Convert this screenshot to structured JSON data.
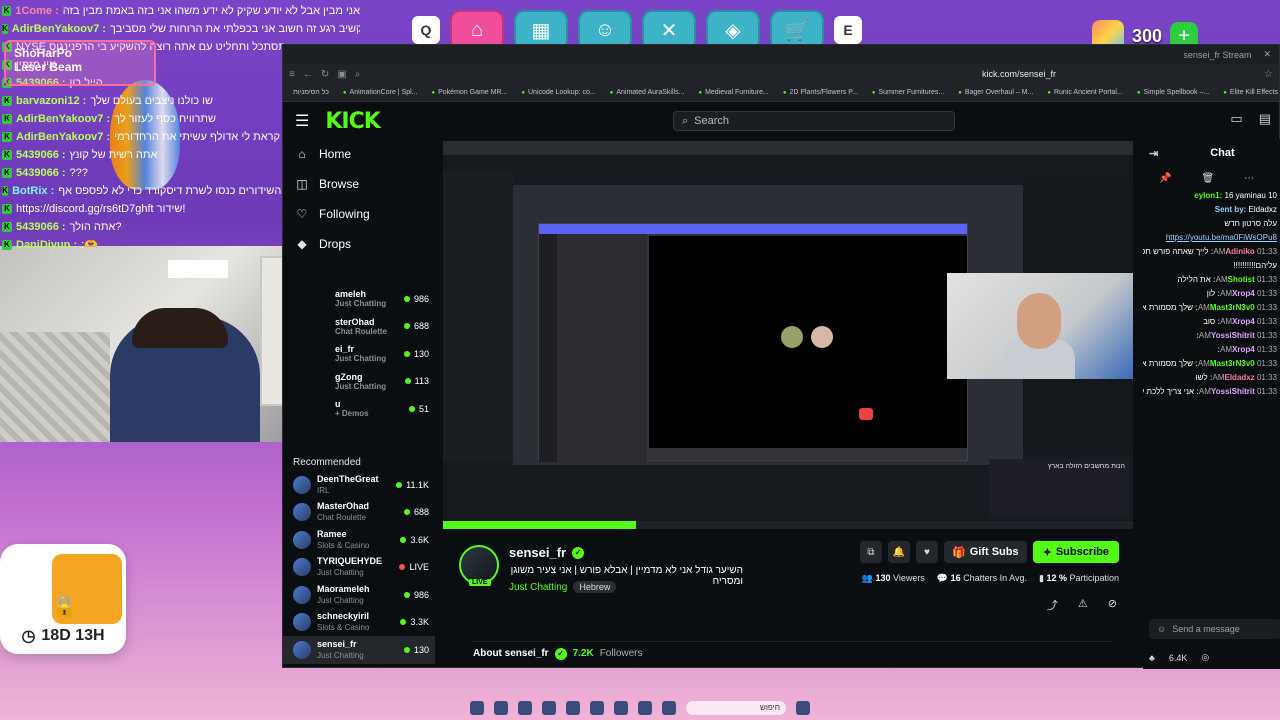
{
  "overlay_chat": [
    {
      "user": "1Come",
      "msg": "אני מבין אבל לא יודע שקיק לא ידע משהו אני בזה באמת מבין בזה",
      "color": "red"
    },
    {
      "user": "AdirBenYakoov7",
      "msg": "תקשיב רגע זה חשוב אני בכפלתי את הרוחות שלי מסביבך",
      "color": "green"
    },
    {
      "user": "",
      "msg": "NYSE תסתכל ותחליט עם אתה רוצה להשקיע בי הרפנינגוס",
      "color": "green"
    },
    {
      "user": "",
      "msg": "אין מזמין",
      "color": "green"
    },
    {
      "user": "5439066",
      "msg": "הייל רון",
      "color": "green"
    },
    {
      "user": "barvazoni12",
      "msg": "שו כולנו ניצבים בעולם שלך",
      "color": "green"
    },
    {
      "user": "AdirBenYakoov7",
      "msg": "שתרוויח כסף לעזור לך",
      "color": "green"
    },
    {
      "user": "AdirBenYakoov7",
      "msg": "למה קראת לי אדולף עשיתי את הרחדורמי",
      "color": "green"
    },
    {
      "user": "5439066",
      "msg": "אתה רשית של קונץ",
      "color": "green"
    },
    {
      "user": "5439066",
      "msg": "???",
      "color": "green"
    },
    {
      "user": "BotRix",
      "msg": "אם אתם נהנים מהשידורים כנסו לשרת דיסקורד כדי לא לפספס אף",
      "color": "teal"
    },
    {
      "user": "",
      "msg": "https://discord.gg/rs6tD7ghft שידור!",
      "color": "teal"
    },
    {
      "user": "5439066",
      "msg": "אתה הולך?",
      "color": "green"
    },
    {
      "user": "DaniDiyun",
      "msg": ":🫶",
      "color": "green"
    }
  ],
  "shop_tag": {
    "line1": "ShoHarPo",
    "line2": "Laser Beam"
  },
  "game_bar": {
    "keys": [
      "Q",
      "E"
    ],
    "coins": "300"
  },
  "timer": {
    "value": "18D 13H"
  },
  "browser": {
    "url": "kick.com/sensei_fr",
    "tab_title": "sensei_fr Stream",
    "bookmarks": [
      "AnimationCore | Spl...",
      "Pokémon Game MR...",
      "Unicode Lookup: co...",
      "Animated AuraSkills...",
      "Medieval Furniture...",
      "2D Plants/Flowers P...",
      "Summer Furnitures...",
      "Bager Overhaul – M...",
      "Runic Ancient Portal...",
      "Simple Spellbook –...",
      "Elite Kill Effects Volu..."
    ],
    "bookmarks_folder": "כל הסימניות"
  },
  "kick": {
    "logo": "KICK",
    "search_placeholder": "Search",
    "nav": [
      {
        "label": "Home",
        "icon": "home-icon",
        "glyph": "⌂"
      },
      {
        "label": "Browse",
        "icon": "browse-icon",
        "glyph": "◫"
      },
      {
        "label": "Following",
        "icon": "heart-icon",
        "glyph": "♡"
      },
      {
        "label": "Drops",
        "icon": "drops-icon",
        "glyph": "◆"
      }
    ],
    "followed": [
      {
        "name": "ameleh",
        "sub": "Just Chatting",
        "count": "986"
      },
      {
        "name": "sterOhad",
        "sub": "Chat Roulette",
        "count": "688"
      },
      {
        "name": "ei_fr",
        "sub": "Just Chatting",
        "count": "130"
      },
      {
        "name": "gZong",
        "sub": "Just Chatting",
        "count": "113"
      },
      {
        "name": "u",
        "sub": "+ Demos",
        "count": "51"
      }
    ],
    "recommended_title": "Recommended",
    "recommended": [
      {
        "name": "DeenTheGreat",
        "cat": "IRL",
        "count": "11.1K",
        "live": false
      },
      {
        "name": "MasterOhad",
        "cat": "Chat Roulette",
        "count": "688",
        "live": false
      },
      {
        "name": "Ramee",
        "cat": "Slots & Casino",
        "count": "3.6K",
        "live": false
      },
      {
        "name": "TYRIQUEHYDE",
        "cat": "Just Chatting",
        "count": "LIVE",
        "live": true
      },
      {
        "name": "Maorameleh",
        "cat": "Just Chatting",
        "count": "986",
        "live": false
      },
      {
        "name": "schneckyiril",
        "cat": "Slots & Casino",
        "count": "3.3K",
        "live": false
      },
      {
        "name": "sensei_fr",
        "cat": "Just Chatting",
        "count": "130",
        "live": false
      }
    ]
  },
  "channel": {
    "name": "sensei_fr",
    "live_badge": "LIVE",
    "title": "השיער גודל אני לא מדמיין | אבלא פורש | אני צעיר משוגן ומסריח",
    "category": "Just Chatting",
    "language": "Hebrew",
    "gift_label": "Gift Subs",
    "subscribe_label": "Subscribe",
    "viewers": "130",
    "viewers_label": "Viewers",
    "chatters": "16",
    "chatters_label": "Chatters In Avg.",
    "participation": "12 %",
    "participation_label": "Participation",
    "about_prefix": "About sensei_fr",
    "followers": "7.2K",
    "followers_label": "Followers"
  },
  "player": {
    "progress": 0.28,
    "banner_text": "הנות מחשבים הזולה בארץ"
  },
  "chat": {
    "title": "Chat",
    "messages": [
      {
        "t": "",
        "u": "eylon1",
        "m": "16  yaminau 10",
        "c": "g"
      },
      {
        "t": "",
        "u": "Sent by",
        "m": "Eldadxz",
        "c": "b"
      },
      {
        "t": "",
        "u": "",
        "m": "עלה סרטון חדש",
        "c": "g"
      },
      {
        "t": "",
        "u": "",
        "m": "https://youtu.be/ma0FiWsOPu8",
        "c": "link"
      },
      {
        "t": "01:33 AM",
        "u": "Adiniko",
        "m": "לייך שאתה פורש תפתח דרמה ותצעק",
        "c": "r"
      },
      {
        "t": "",
        "u": "",
        "m": "עליהם!!!!!!!!!!",
        "c": "g"
      },
      {
        "t": "01:33 AM",
        "u": "Shotist",
        "m": "את הלילה",
        "c": "g"
      },
      {
        "t": "01:33 AM",
        "u": "Xrop4",
        "m": "לון",
        "c": "p"
      },
      {
        "t": "01:33 AM",
        "u": "Mast3rN3v0",
        "m": "שלך מסמורת אותי שים כובע",
        "c": "g"
      },
      {
        "t": "01:33 AM",
        "u": "Xrop4",
        "m": "סוב",
        "c": "p"
      },
      {
        "t": "01:33 AM",
        "u": "YossiShitrit",
        "m": "",
        "c": "p"
      },
      {
        "t": "01:33 AM",
        "u": "Xrop4",
        "m": "",
        "c": "p"
      },
      {
        "t": "01:33 AM",
        "u": "Mast3rN3v0",
        "m": "שלך מסמורת אותי שים כובע",
        "c": "g"
      },
      {
        "t": "01:33 AM",
        "u": "Eldadxz",
        "m": "לשו",
        "c": "r"
      },
      {
        "t": "01:33 AM",
        "u": "YossiShitrit",
        "m": "אני צריך ללכת לישון כי אני עובד מחר",
        "c": "p"
      }
    ],
    "send_placeholder": "Send a message",
    "points": "6.4K"
  },
  "taskbar": {
    "search": "חיפוש"
  }
}
